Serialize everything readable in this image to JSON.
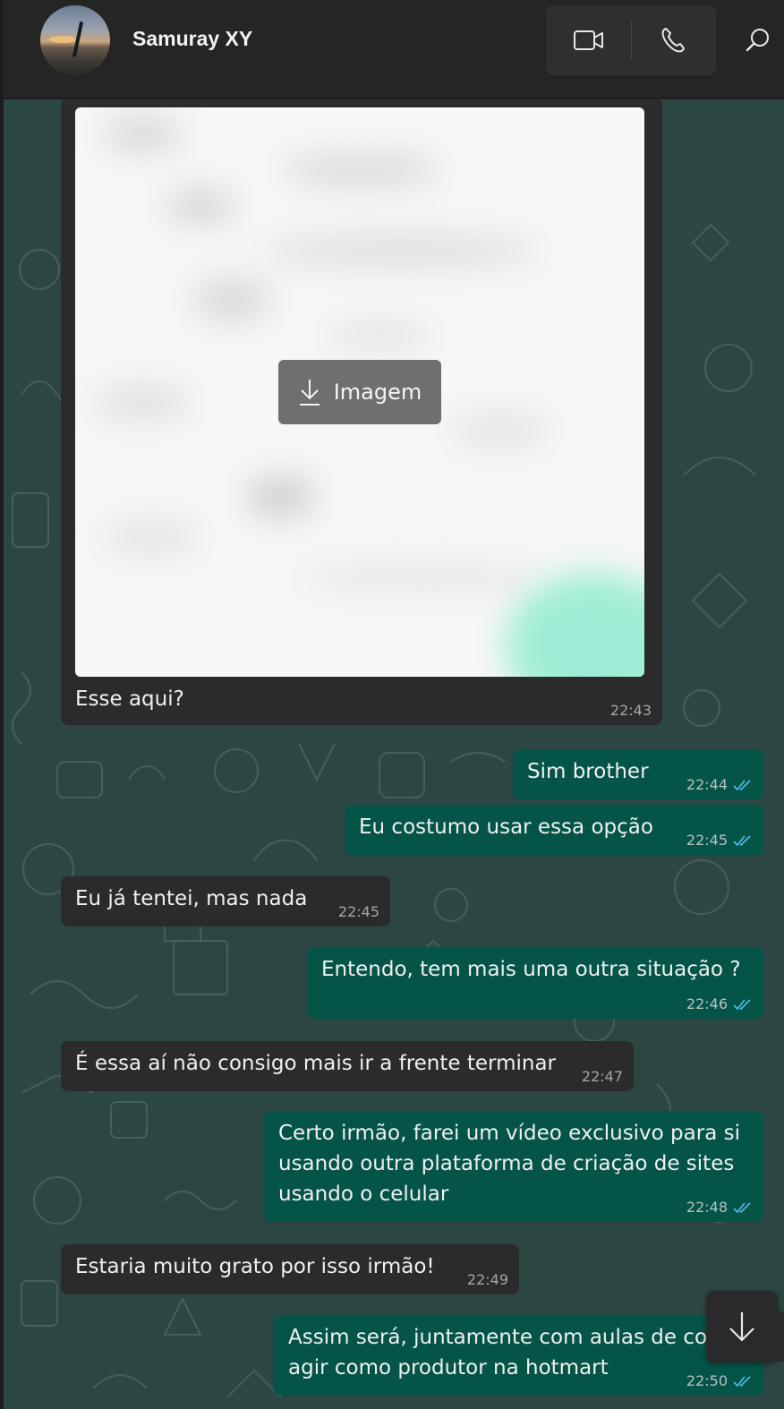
{
  "header": {
    "contact_name": "Samuray XY"
  },
  "image_message": {
    "download_label": "Imagem",
    "caption": "Esse aqui?",
    "time": "22:43"
  },
  "messages": [
    {
      "direction": "out",
      "text": "Sim brother",
      "time": "22:44"
    },
    {
      "direction": "out",
      "text": "Eu costumo usar essa opção",
      "time": "22:45"
    },
    {
      "direction": "in",
      "text": "Eu já tentei, mas nada",
      "time": "22:45"
    },
    {
      "direction": "out",
      "text": "Entendo, tem mais uma outra situação ?",
      "time": "22:46"
    },
    {
      "direction": "in",
      "text": "É essa aí não consigo mais ir a frente terminar",
      "time": "22:47"
    },
    {
      "direction": "out",
      "lines": [
        "Certo irmão, farei um vídeo exclusivo para si",
        "usando outra plataforma de criação de sites",
        "usando o celular"
      ],
      "time": "22:48"
    },
    {
      "direction": "in",
      "text": "Estaria muito grato por isso irmão!",
      "time": "22:49"
    },
    {
      "direction": "out",
      "lines": [
        "Assim será, juntamente com aulas de con",
        "agir como produtor na hotmart"
      ],
      "time": "22:50"
    }
  ],
  "colors": {
    "incoming_bubble": "#2b2b2b",
    "outgoing_bubble": "#045448",
    "chat_background": "#2c4644",
    "read_tick": "#53bdeb"
  },
  "icons": [
    "video-call-icon",
    "phone-icon",
    "search-icon",
    "download-icon",
    "double-check-icon",
    "arrow-down-icon"
  ]
}
